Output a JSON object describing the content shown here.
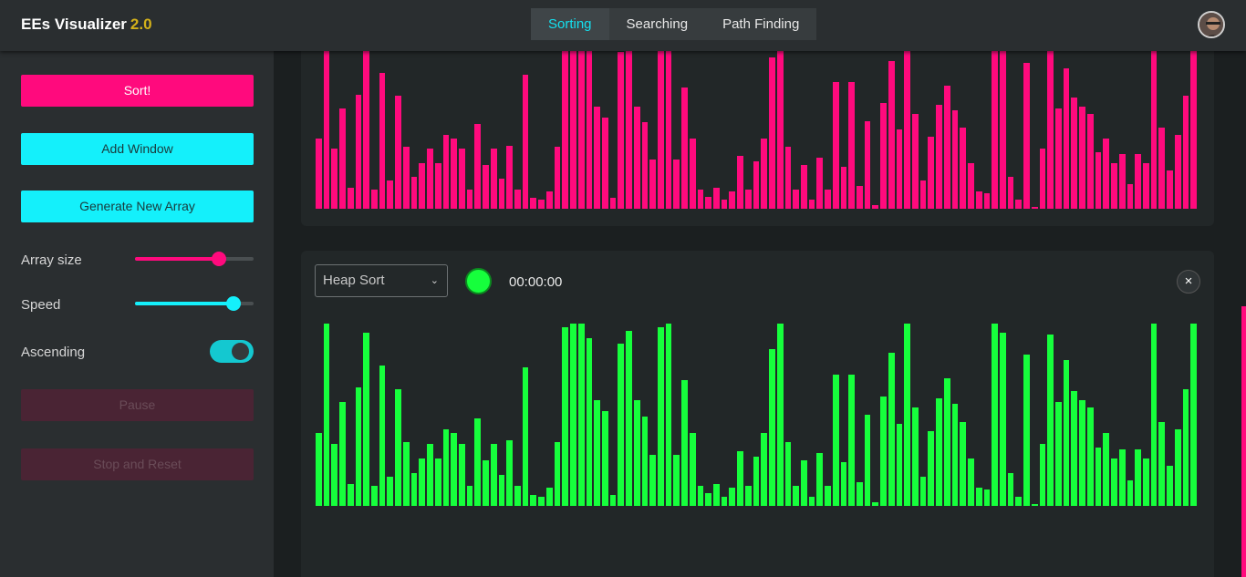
{
  "header": {
    "app_title": "EEs Visualizer",
    "version": "2.0",
    "tabs": [
      {
        "label": "Sorting",
        "active": true
      },
      {
        "label": "Searching",
        "active": false
      },
      {
        "label": "Path Finding",
        "active": false
      }
    ]
  },
  "sidebar": {
    "sort_label": "Sort!",
    "add_window_label": "Add Window",
    "generate_label": "Generate New Array",
    "array_size_label": "Array size",
    "array_size_value": 0.71,
    "speed_label": "Speed",
    "speed_value": 0.83,
    "ascending_label": "Ascending",
    "ascending_on": true,
    "pause_label": "Pause",
    "stop_label": "Stop and Reset"
  },
  "windows": [
    {
      "color": "#ff0a7d",
      "values": [
        40,
        100,
        34,
        57,
        12,
        65,
        95,
        11,
        77,
        16,
        64,
        35,
        18,
        26,
        34,
        26,
        42,
        40,
        34,
        11,
        48,
        25,
        34,
        17,
        36,
        11,
        76,
        6,
        5,
        10,
        35,
        98,
        100,
        100,
        92,
        58,
        52,
        6,
        89,
        96,
        58,
        49,
        28,
        98,
        100,
        28,
        69,
        40,
        11,
        7,
        12,
        5,
        10,
        30,
        11,
        27,
        40,
        86,
        100,
        35,
        11,
        25,
        5,
        29,
        11,
        72,
        24,
        72,
        13,
        50,
        2,
        60,
        84,
        45,
        100,
        54,
        16,
        41,
        59,
        70,
        56,
        46,
        26,
        10,
        9,
        100,
        95,
        18,
        5,
        83,
        0.8,
        34,
        94,
        57,
        80,
        63,
        58,
        54,
        32,
        40,
        26,
        31,
        14,
        31,
        26,
        100,
        46,
        22,
        42,
        64,
        100
      ]
    },
    {
      "color": "#16ff3c",
      "values": [
        40,
        100,
        34,
        57,
        12,
        65,
        95,
        11,
        77,
        16,
        64,
        35,
        18,
        26,
        34,
        26,
        42,
        40,
        34,
        11,
        48,
        25,
        34,
        17,
        36,
        11,
        76,
        6,
        5,
        10,
        35,
        98,
        100,
        100,
        92,
        58,
        52,
        6,
        89,
        96,
        58,
        49,
        28,
        98,
        100,
        28,
        69,
        40,
        11,
        7,
        12,
        5,
        10,
        30,
        11,
        27,
        40,
        86,
        100,
        35,
        11,
        25,
        5,
        29,
        11,
        72,
        24,
        72,
        13,
        50,
        2,
        60,
        84,
        45,
        100,
        54,
        16,
        41,
        59,
        70,
        56,
        46,
        26,
        10,
        9,
        100,
        95,
        18,
        5,
        83,
        0.8,
        34,
        94,
        57,
        80,
        63,
        58,
        54,
        32,
        40,
        26,
        31,
        14,
        31,
        26,
        100,
        46,
        22,
        42,
        64,
        100
      ],
      "algorithm": "Heap Sort",
      "timer": "00:00:00",
      "close_icon": "×",
      "chevron_icon": "⌄"
    }
  ]
}
